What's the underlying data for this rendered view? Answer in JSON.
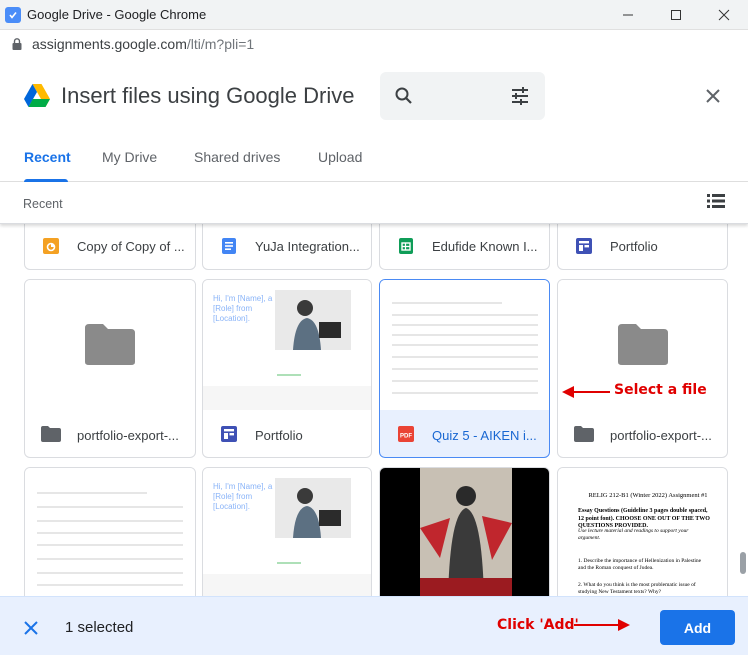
{
  "window": {
    "title": "Google Drive - Google Chrome"
  },
  "address": {
    "host": "assignments.google.com",
    "path": "/lti/m?pli=1"
  },
  "picker": {
    "title": "Insert files using Google Drive",
    "tabs": [
      {
        "label": "Recent",
        "active": true
      },
      {
        "label": "My Drive"
      },
      {
        "label": "Shared drives"
      },
      {
        "label": "Upload"
      }
    ],
    "breadcrumb": "Recent"
  },
  "files": {
    "row1": [
      {
        "name": "Copy of Copy of ...",
        "icon": "slides-icon"
      },
      {
        "name": "YuJa Integration...",
        "icon": "docs-icon"
      },
      {
        "name": "Edufide Known I...",
        "icon": "sheets-icon"
      },
      {
        "name": "Portfolio",
        "icon": "sites-icon"
      }
    ],
    "row2": [
      {
        "name": "portfolio-export-...",
        "icon": "folder-icon"
      },
      {
        "name": "Portfolio",
        "icon": "sites-icon"
      },
      {
        "name": "Quiz 5 - AIKEN i...",
        "icon": "pdf-icon",
        "selected": true
      },
      {
        "name": "portfolio-export-...",
        "icon": "folder-icon"
      }
    ],
    "pdf_label": "PDF",
    "site_thumb_text": "Hi, I'm [Name], a [Role] from [Location].",
    "exam_thumb": {
      "title": "RELIG 212-B1 (Winter 2022) Assignment #1",
      "line1": "Essay Questions (Guideline 3 pages double spaced, 12 point font). CHOOSE ONE OUT OF THE TWO QUESTIONS PROVIDED.",
      "line2": "Use lecture material and readings to support your argument.",
      "q1": "1.   Describe the importance of Hellenization in Palestine and the Roman conquest of Judea.",
      "q2": "2.   What do you think is the most problematic issue of studying New Testament texts? Why?"
    }
  },
  "footer": {
    "selected_text": "1 selected",
    "add_label": "Add"
  },
  "annotations": {
    "select_file": "Select a file",
    "click_add": "Click 'Add'"
  },
  "colors": {
    "accent": "#1a73e8",
    "annotation": "#e00000"
  }
}
